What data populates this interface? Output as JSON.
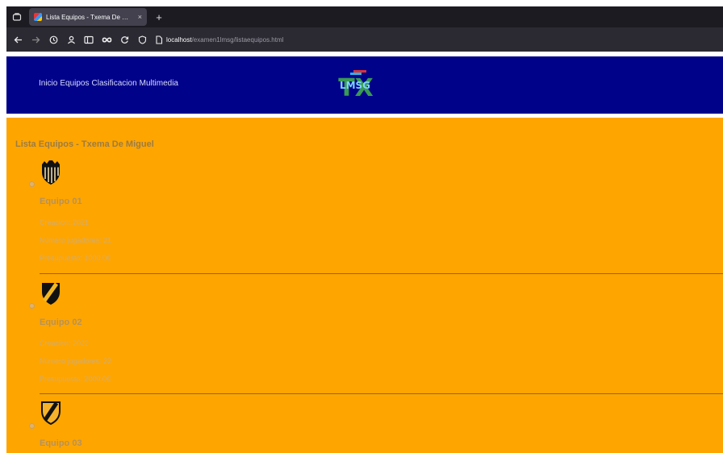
{
  "browser": {
    "tab_title": "Lista Equipos - Txema De Miguel",
    "tab_close": "×",
    "new_tab": "+",
    "url_host": "localhost",
    "url_path": "/examen1lmsg/listaequipos.html"
  },
  "site": {
    "nav": [
      "Inicio",
      "Equipos",
      "Clasificacion",
      "Multimedia"
    ],
    "logo_text": "LMSG",
    "logo_mark": "TX"
  },
  "page": {
    "title": "Lista Equipos - Txema De Miguel"
  },
  "teams": [
    {
      "name": "Equipo 01",
      "creacion": "Creacion: 2021",
      "jugadores": "Número jugadores: 21",
      "presupuesto": "Presupuesto: 1000.0€",
      "crest": "striped-shield-icon"
    },
    {
      "name": "Equipo 02",
      "creacion": "Creacion: 2022",
      "jugadores": "Número jugadores: 22",
      "presupuesto": "Presupuesto: 2000.0€",
      "crest": "diagonal-shield-icon"
    },
    {
      "name": "Equipo 03",
      "crest": "diagonal-shield-outline-icon"
    }
  ],
  "colors": {
    "header_bg": "#01028a",
    "content_bg": "#ffa500",
    "browser_bg": "#1c1b22"
  }
}
